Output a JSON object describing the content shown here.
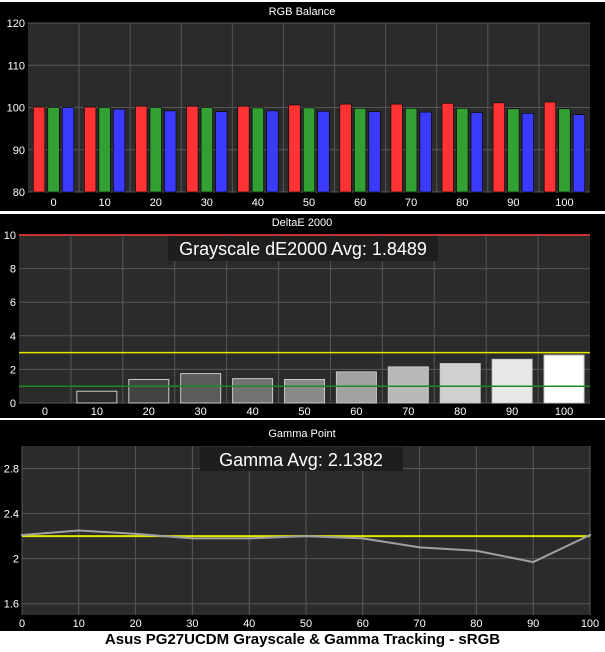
{
  "caption": "Asus PG27UCDM Grayscale & Gamma Tracking - sRGB",
  "colors": {
    "panel_bg": "#000000",
    "plot_bg": "#2b2b2b",
    "grid": "#575757",
    "text": "#ffffff",
    "red": "#ff3333",
    "green": "#33a033",
    "blue": "#3b3bff",
    "yellow": "#e6e600",
    "threshold_green": "#1f8a1f",
    "gamma_line": "#a0a0a0"
  },
  "chart_data": [
    {
      "type": "bar",
      "title": "RGB Balance",
      "categories": [
        "0",
        "10",
        "20",
        "30",
        "40",
        "50",
        "60",
        "70",
        "80",
        "90",
        "100"
      ],
      "ylim": [
        80,
        120
      ],
      "yticks": [
        80,
        90,
        100,
        110,
        120
      ],
      "grid": true,
      "series": [
        {
          "color": "red",
          "values": [
            100.1,
            100.1,
            100.3,
            100.3,
            100.3,
            100.6,
            100.8,
            100.8,
            101.0,
            101.1,
            101.3
          ]
        },
        {
          "color": "green",
          "values": [
            100.0,
            100.0,
            100.0,
            100.0,
            99.9,
            99.9,
            99.8,
            99.8,
            99.8,
            99.7,
            99.7
          ]
        },
        {
          "color": "blue",
          "values": [
            100.0,
            99.6,
            99.2,
            99.0,
            99.2,
            99.1,
            99.0,
            98.9,
            98.8,
            98.6,
            98.3
          ]
        }
      ]
    },
    {
      "type": "bar",
      "title": "DeltaE 2000",
      "annotation": "Grayscale dE2000 Avg: 1.8489",
      "categories": [
        "0",
        "10",
        "20",
        "30",
        "40",
        "50",
        "60",
        "70",
        "80",
        "90",
        "100"
      ],
      "values": [
        0,
        0.7,
        1.4,
        1.75,
        1.45,
        1.4,
        1.85,
        2.15,
        2.35,
        2.6,
        2.85
      ],
      "ylim": [
        0,
        10
      ],
      "yticks": [
        0,
        2,
        4,
        6,
        8,
        10
      ],
      "reference_lines": [
        3,
        1
      ],
      "grid": true
    },
    {
      "type": "line",
      "title": "Gamma Point",
      "annotation": "Gamma Avg: 2.1382",
      "x": [
        0,
        10,
        20,
        30,
        40,
        50,
        60,
        70,
        80,
        90,
        100
      ],
      "xticks": [
        0,
        10,
        20,
        30,
        40,
        50,
        60,
        70,
        80,
        90,
        100
      ],
      "y": [
        2.21,
        2.25,
        2.22,
        2.18,
        2.18,
        2.2,
        2.18,
        2.1,
        2.07,
        1.97,
        2.21
      ],
      "target": 2.2,
      "xlim": [
        0,
        100
      ],
      "ylim": [
        1.5,
        3.0
      ],
      "yticks": [
        1.6,
        2,
        2.4,
        2.8
      ],
      "grid": true
    }
  ]
}
